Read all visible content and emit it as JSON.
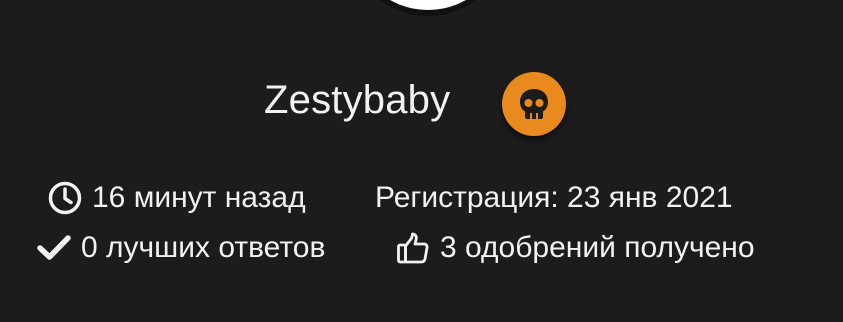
{
  "profile": {
    "username": "Zestybaby",
    "rank_icon": "skull-icon",
    "rank_color": "#e98a1f"
  },
  "stats": {
    "last_seen": {
      "icon": "clock-icon",
      "text": "16 минут назад"
    },
    "registered": {
      "text": "Регистрация: 23 янв 2021"
    },
    "best_answers": {
      "icon": "checkmark-icon",
      "text": "0 лучших ответов"
    },
    "likes": {
      "icon": "thumbs-up-icon",
      "text": "3 одобрений получено"
    }
  }
}
